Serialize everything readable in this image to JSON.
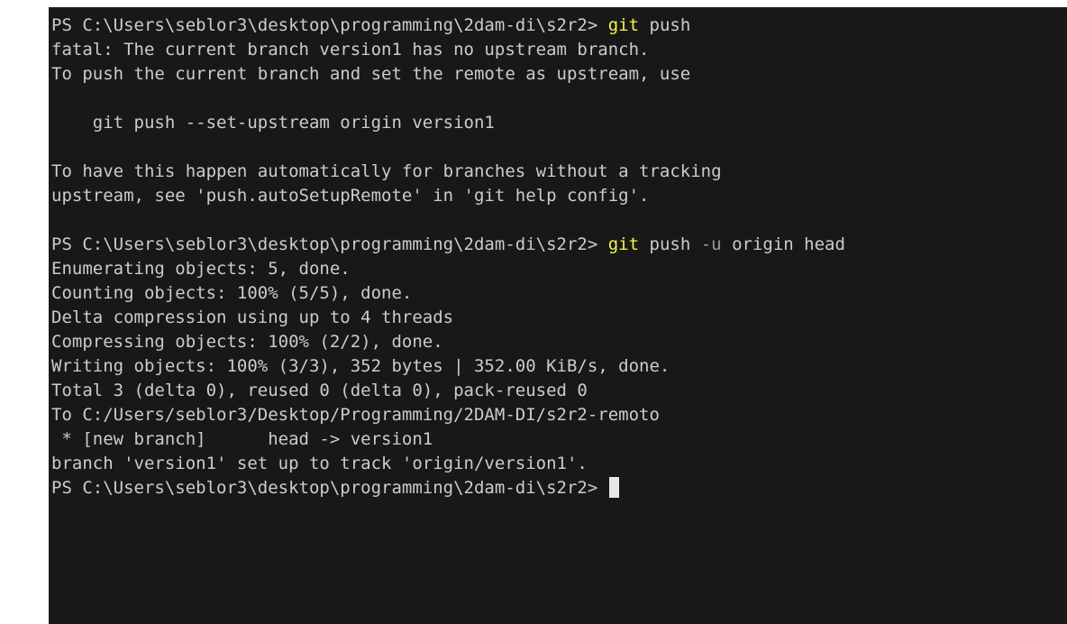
{
  "prompt_path": "PS C:\\Users\\seblor3\\desktop\\programming\\2dam-di\\s2r2>",
  "command1": {
    "cmd": "git",
    "args": "push"
  },
  "output1": [
    "fatal: The current branch version1 has no upstream branch.",
    "To push the current branch and set the remote as upstream, use",
    "",
    "    git push --set-upstream origin version1",
    "",
    "To have this happen automatically for branches without a tracking",
    "upstream, see 'push.autoSetupRemote' in 'git help config'.",
    ""
  ],
  "command2": {
    "cmd": "git",
    "args_a": "push",
    "flag": "-u",
    "args_b": "origin head"
  },
  "output2": [
    "Enumerating objects: 5, done.",
    "Counting objects: 100% (5/5), done.",
    "Delta compression using up to 4 threads",
    "Compressing objects: 100% (2/2), done.",
    "Writing objects: 100% (3/3), 352 bytes | 352.00 KiB/s, done.",
    "Total 3 (delta 0), reused 0 (delta 0), pack-reused 0",
    "To C:/Users/seblor3/Desktop/Programming/2DAM-DI/s2r2-remoto",
    " * [new branch]      head -> version1",
    "branch 'version1' set up to track 'origin/version1'."
  ],
  "colors": {
    "background": "#181818",
    "text": "#cccccc",
    "command": "#f5f543",
    "flag": "#9a9a9a",
    "cursor": "#e6e6e6"
  }
}
